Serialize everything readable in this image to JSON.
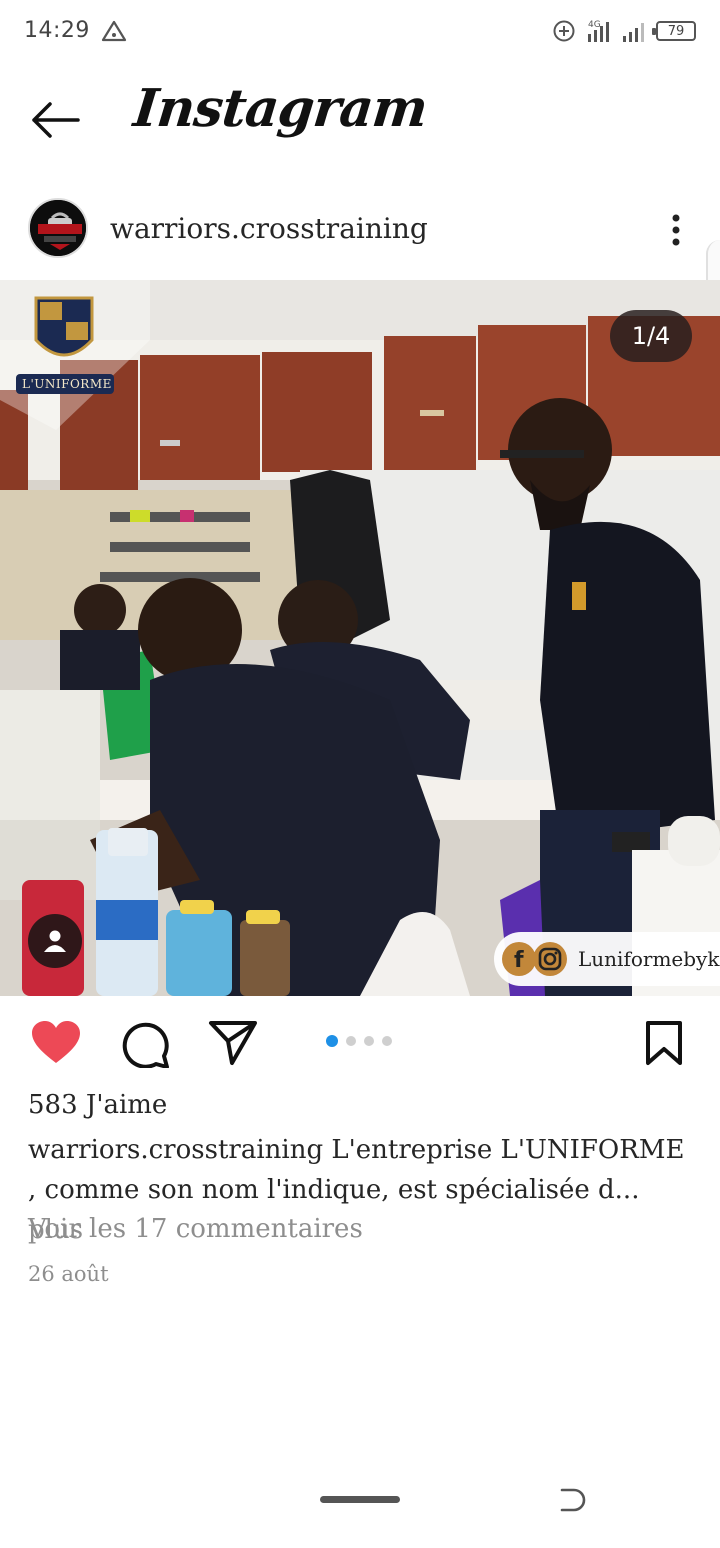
{
  "status_bar": {
    "time": "14:29",
    "network": "4G",
    "battery": "79",
    "icons": [
      "alert-triangle-icon",
      "data-saver-icon",
      "signal-icon",
      "signal-icon-2",
      "battery-icon"
    ]
  },
  "header": {
    "title": "Instagram",
    "back_icon": "arrow-left-icon"
  },
  "post": {
    "username": "warriors.crosstraining",
    "avatar_icon": "profile-avatar",
    "more_icon": "more-vertical-icon",
    "image": {
      "counter": "1/4",
      "logo_text": "L'UNIFORME",
      "brand_tag": "Luniformebyk",
      "tag_icon": "person-icon"
    },
    "actions": {
      "like_icon": "heart-icon",
      "comment_icon": "comment-icon",
      "share_icon": "send-icon",
      "save_icon": "bookmark-icon",
      "carousel": {
        "total": 4,
        "active": 1
      }
    },
    "likes": "583 J'aime",
    "caption_user": "warriors.crosstraining",
    "caption_text": " L'entreprise L'UNIFORME , comme son nom l'indique, est spécialisée d...",
    "caption_more": " plus",
    "view_comments": "Voir les 17 commentaires",
    "date": "26 août"
  },
  "colors": {
    "like": "#ED4956",
    "accent_dot": "#1E90E6",
    "muted_text": "#8E8E8E"
  }
}
